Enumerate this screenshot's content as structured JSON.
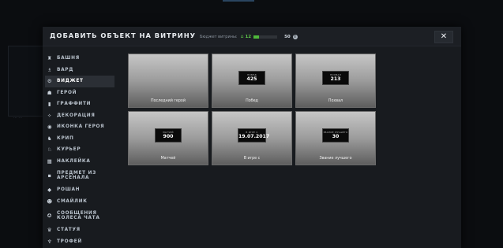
{
  "dialog": {
    "title": "ДОБАВИТЬ ОБЪЕКТ НА ВИТРИНУ",
    "close_label": "✕",
    "budget": {
      "label": "Бюджет витрины:",
      "used": "12",
      "total": "50",
      "progress_percent": 24,
      "icon": "home-icon",
      "accent_color": "#5ec44a"
    }
  },
  "sidebar": {
    "items": [
      {
        "label": "БАШНЯ",
        "icon": "tower-icon",
        "glyph": "♜"
      },
      {
        "label": "ВАРД",
        "icon": "ward-icon",
        "glyph": "♗"
      },
      {
        "label": "ВИДЖЕТ",
        "icon": "widget-icon",
        "glyph": "⚙",
        "active": true
      },
      {
        "label": "ГЕРОЙ",
        "icon": "hero-icon",
        "glyph": "☗"
      },
      {
        "label": "ГРАФФИТИ",
        "icon": "graffiti-icon",
        "glyph": "▮"
      },
      {
        "label": "ДЕКОРАЦИЯ",
        "icon": "decoration-icon",
        "glyph": "✧"
      },
      {
        "label": "ИКОНКА ГЕРОЯ",
        "icon": "hero-icon-icon",
        "glyph": "◉"
      },
      {
        "label": "КРИП",
        "icon": "creep-icon",
        "glyph": "♞"
      },
      {
        "label": "КУРЬЕР",
        "icon": "courier-icon",
        "glyph": "♘"
      },
      {
        "label": "НАКЛЕЙКА",
        "icon": "sticker-icon",
        "glyph": "▦"
      },
      {
        "label": "ПРЕДМЕТ ИЗ",
        "label2": "АРСЕНАЛА",
        "icon": "armory-item-icon",
        "glyph": "▪"
      },
      {
        "label": "РОШАН",
        "icon": "roshan-icon",
        "glyph": "◆"
      },
      {
        "label": "СМАЙЛИК",
        "icon": "emoticon-icon",
        "glyph": "☻"
      },
      {
        "label": "СООБЩЕНИЯ",
        "label2": "КОЛЕСА ЧАТА",
        "icon": "chat-wheel-icon",
        "glyph": "✪"
      },
      {
        "label": "СТАТУЯ",
        "icon": "statue-icon",
        "glyph": "♛"
      },
      {
        "label": "ТРОФЕЙ",
        "icon": "trophy-icon",
        "glyph": "♆"
      }
    ]
  },
  "tiles": [
    {
      "caption": "Последний герой",
      "plate": null
    },
    {
      "caption": "Побед",
      "plate": {
        "small": "ПОБЕД",
        "big": "425"
      }
    },
    {
      "caption": "Похвал",
      "plate": {
        "small": "ПОХВАЛ",
        "big": "213"
      }
    },
    {
      "caption": "Матчей",
      "plate": {
        "small": "МАТЧЕЙ",
        "big": "900"
      }
    },
    {
      "caption": "В игре с",
      "plate": {
        "small": "В ИГРЕ С",
        "big": "19.07.2017"
      }
    },
    {
      "caption": "Звание лучшего",
      "plate": {
        "small": "ЗВАНИЕ ЛУЧШЕГО",
        "big": "30"
      }
    }
  ],
  "background": {
    "label": "... ..."
  }
}
